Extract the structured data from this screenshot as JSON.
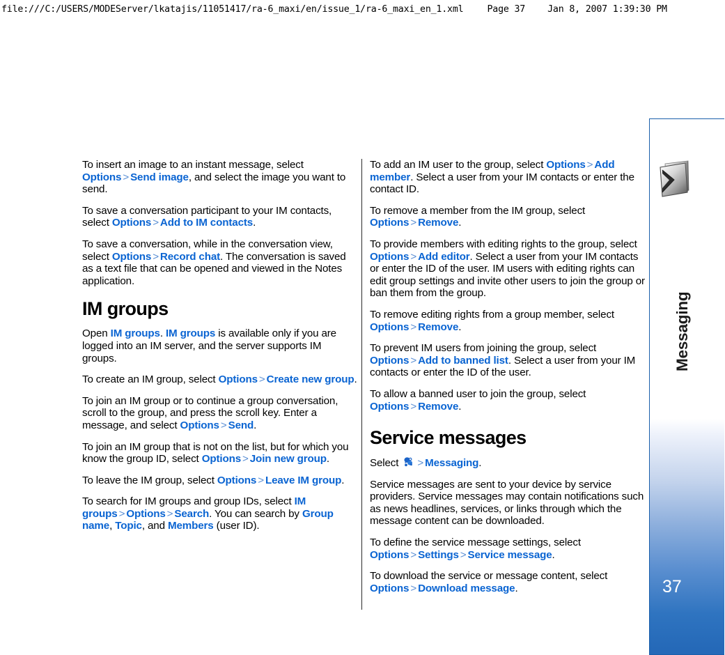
{
  "print_header": {
    "url": "file:///C:/USERS/MODEServer/lkatajis/11051417/ra-6_maxi/en/issue_1/ra-6_maxi_en_1.xml",
    "page_label": "Page 37",
    "timestamp": "Jan 8, 2007 1:39:30 PM"
  },
  "chapter_tab": {
    "title": "Messaging",
    "page_number": "37",
    "icon": "envelope-icon",
    "border_color": "#1a5fab",
    "gradient_bottom_color": "#2569b8"
  },
  "colors": {
    "link": "#0a64d2",
    "separator": "#5b8fd4",
    "body_text": "#000000"
  },
  "separator_glyph": ">",
  "left_column": {
    "paragraphs": [
      {
        "id": "insert-image",
        "runs": [
          {
            "t": "To insert an image to an instant message, select ",
            "s": "plain"
          },
          {
            "t": "Options",
            "s": "link"
          },
          {
            "t": ">",
            "s": "sep"
          },
          {
            "t": "Send image",
            "s": "link"
          },
          {
            "t": ", and select the image you want to send.",
            "s": "plain"
          }
        ]
      },
      {
        "id": "save-participant",
        "runs": [
          {
            "t": "To save a conversation participant to your IM contacts, select ",
            "s": "plain"
          },
          {
            "t": "Options",
            "s": "link"
          },
          {
            "t": ">",
            "s": "sep"
          },
          {
            "t": "Add to IM contacts",
            "s": "link"
          },
          {
            "t": ".",
            "s": "plain"
          }
        ]
      },
      {
        "id": "save-conversation",
        "runs": [
          {
            "t": "To save a conversation, while in the conversation view, select ",
            "s": "plain"
          },
          {
            "t": "Options",
            "s": "link"
          },
          {
            "t": ">",
            "s": "sep"
          },
          {
            "t": "Record chat",
            "s": "link"
          },
          {
            "t": ". The conversation is saved as a text file that can be opened and viewed in the Notes application.",
            "s": "plain"
          }
        ]
      }
    ],
    "heading": "IM groups",
    "paragraphs_after_heading": [
      {
        "id": "open-im-groups",
        "runs": [
          {
            "t": "Open ",
            "s": "plain"
          },
          {
            "t": "IM groups",
            "s": "link"
          },
          {
            "t": ". ",
            "s": "plain"
          },
          {
            "t": "IM groups",
            "s": "link"
          },
          {
            "t": " is available only if you are logged into an IM server, and the server supports IM groups.",
            "s": "plain"
          }
        ]
      },
      {
        "id": "create-group",
        "runs": [
          {
            "t": "To create an IM group, select ",
            "s": "plain"
          },
          {
            "t": "Options",
            "s": "link"
          },
          {
            "t": ">",
            "s": "sep"
          },
          {
            "t": "Create new group",
            "s": "link"
          },
          {
            "t": ".",
            "s": "plain"
          }
        ]
      },
      {
        "id": "join-group",
        "runs": [
          {
            "t": "To join an IM group or to continue a group conversation, scroll to the group, and press the scroll key. Enter a message, and select ",
            "s": "plain"
          },
          {
            "t": "Options",
            "s": "link"
          },
          {
            "t": ">",
            "s": "sep"
          },
          {
            "t": "Send",
            "s": "link"
          },
          {
            "t": ".",
            "s": "plain"
          }
        ]
      },
      {
        "id": "join-new-group",
        "runs": [
          {
            "t": "To join an IM group that is not on the list, but for which you know the group ID, select ",
            "s": "plain"
          },
          {
            "t": "Options",
            "s": "link"
          },
          {
            "t": ">",
            "s": "sep"
          },
          {
            "t": "Join new group",
            "s": "link"
          },
          {
            "t": ".",
            "s": "plain"
          }
        ]
      },
      {
        "id": "leave-group",
        "runs": [
          {
            "t": "To leave the IM group, select ",
            "s": "plain"
          },
          {
            "t": "Options",
            "s": "link"
          },
          {
            "t": ">",
            "s": "sep"
          },
          {
            "t": "Leave IM group",
            "s": "link"
          },
          {
            "t": ".",
            "s": "plain"
          }
        ]
      },
      {
        "id": "search-groups",
        "runs": [
          {
            "t": "To search for IM groups and group IDs, select ",
            "s": "plain"
          },
          {
            "t": "IM groups",
            "s": "link"
          },
          {
            "t": ">",
            "s": "sep"
          },
          {
            "t": "Options",
            "s": "link"
          },
          {
            "t": ">",
            "s": "sep"
          },
          {
            "t": "Search",
            "s": "link"
          },
          {
            "t": ". You can search by ",
            "s": "plain"
          },
          {
            "t": "Group name",
            "s": "link"
          },
          {
            "t": ", ",
            "s": "plain"
          },
          {
            "t": "Topic",
            "s": "link"
          },
          {
            "t": ", and ",
            "s": "plain"
          },
          {
            "t": "Members",
            "s": "link"
          },
          {
            "t": " (user ID).",
            "s": "plain"
          }
        ]
      }
    ]
  },
  "right_column": {
    "paragraphs": [
      {
        "id": "add-member",
        "runs": [
          {
            "t": "To add an IM user to the group, select ",
            "s": "plain"
          },
          {
            "t": "Options",
            "s": "link"
          },
          {
            "t": ">",
            "s": "sep"
          },
          {
            "t": "Add member",
            "s": "link"
          },
          {
            "t": ". Select a user from your IM contacts or enter the contact ID.",
            "s": "plain"
          }
        ]
      },
      {
        "id": "remove-member",
        "runs": [
          {
            "t": "To remove a member from the IM group, select ",
            "s": "plain"
          },
          {
            "t": "Options",
            "s": "link"
          },
          {
            "t": ">",
            "s": "sep"
          },
          {
            "t": "Remove",
            "s": "link"
          },
          {
            "t": ".",
            "s": "plain"
          }
        ]
      },
      {
        "id": "add-editor",
        "runs": [
          {
            "t": "To provide members with editing rights to the group, select ",
            "s": "plain"
          },
          {
            "t": "Options",
            "s": "link"
          },
          {
            "t": ">",
            "s": "sep"
          },
          {
            "t": "Add editor",
            "s": "link"
          },
          {
            "t": ". Select a user from your IM contacts or enter the ID of the user. IM users with editing rights can edit group settings and invite other users to join the group or ban them from the group.",
            "s": "plain"
          }
        ]
      },
      {
        "id": "remove-editing-rights",
        "runs": [
          {
            "t": "To remove editing rights from a group member, select ",
            "s": "plain"
          },
          {
            "t": "Options",
            "s": "link"
          },
          {
            "t": ">",
            "s": "sep"
          },
          {
            "t": "Remove",
            "s": "link"
          },
          {
            "t": ".",
            "s": "plain"
          }
        ]
      },
      {
        "id": "add-to-banned-list",
        "runs": [
          {
            "t": "To prevent IM users from joining the group, select ",
            "s": "plain"
          },
          {
            "t": "Options",
            "s": "link"
          },
          {
            "t": ">",
            "s": "sep"
          },
          {
            "t": "Add to banned list",
            "s": "link"
          },
          {
            "t": ". Select a user from your IM contacts or enter the ID of the user.",
            "s": "plain"
          }
        ]
      },
      {
        "id": "allow-banned-user",
        "runs": [
          {
            "t": "To allow a banned user to join the group, select ",
            "s": "plain"
          },
          {
            "t": "Options",
            "s": "link"
          },
          {
            "t": ">",
            "s": "sep"
          },
          {
            "t": "Remove",
            "s": "link"
          },
          {
            "t": ".",
            "s": "plain"
          }
        ]
      }
    ],
    "heading": "Service messages",
    "paragraphs_after_heading": [
      {
        "id": "select-messaging",
        "runs": [
          {
            "t": "Select ",
            "s": "plain"
          },
          {
            "t": "menu-icon",
            "s": "icon"
          },
          {
            "t": ">",
            "s": "sep"
          },
          {
            "t": "Messaging",
            "s": "link"
          },
          {
            "t": ".",
            "s": "plain"
          }
        ]
      },
      {
        "id": "service-messages-intro",
        "runs": [
          {
            "t": "Service messages are sent to your device by service providers. Service messages may contain notifications such as news headlines, services, or links through which the message content can be downloaded.",
            "s": "plain"
          }
        ]
      },
      {
        "id": "define-settings",
        "runs": [
          {
            "t": "To define the service message settings, select ",
            "s": "plain"
          },
          {
            "t": "Options",
            "s": "link"
          },
          {
            "t": ">",
            "s": "sep"
          },
          {
            "t": "Settings",
            "s": "link"
          },
          {
            "t": ">",
            "s": "sep"
          },
          {
            "t": "Service message",
            "s": "link"
          },
          {
            "t": ".",
            "s": "plain"
          }
        ]
      },
      {
        "id": "download-message",
        "runs": [
          {
            "t": "To download the service or message content, select ",
            "s": "plain"
          },
          {
            "t": "Options",
            "s": "link"
          },
          {
            "t": ">",
            "s": "sep"
          },
          {
            "t": "Download message",
            "s": "link"
          },
          {
            "t": ".",
            "s": "plain"
          }
        ]
      }
    ]
  }
}
